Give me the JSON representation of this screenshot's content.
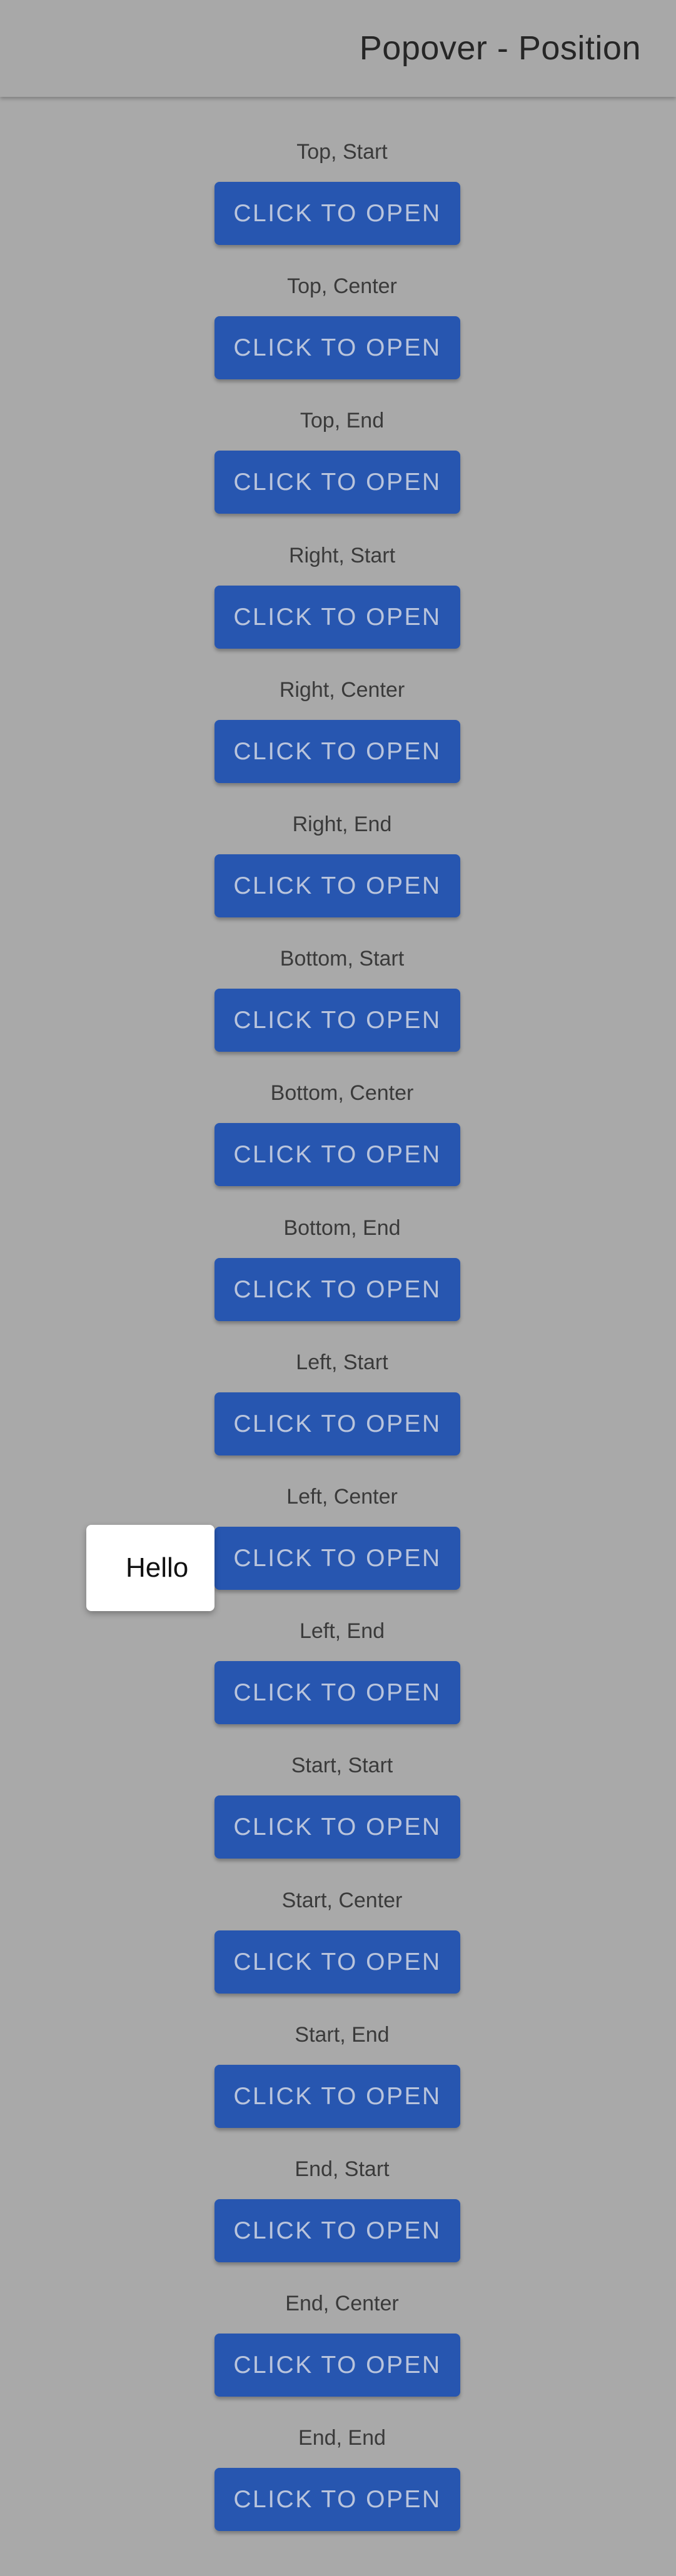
{
  "header": {
    "title": "Popover - Position"
  },
  "button_label": "CLICK TO OPEN",
  "popover": {
    "text": "Hello"
  },
  "rows": [
    {
      "label": "Top, Start"
    },
    {
      "label": "Top, Center"
    },
    {
      "label": "Top, End"
    },
    {
      "label": "Right, Start"
    },
    {
      "label": "Right, Center"
    },
    {
      "label": "Right, End"
    },
    {
      "label": "Bottom, Start"
    },
    {
      "label": "Bottom, Center"
    },
    {
      "label": "Bottom, End"
    },
    {
      "label": "Left, Start"
    },
    {
      "label": "Left, Center"
    },
    {
      "label": "Left, End"
    },
    {
      "label": "Start, Start"
    },
    {
      "label": "Start, Center"
    },
    {
      "label": "Start, End"
    },
    {
      "label": "End, Start"
    },
    {
      "label": "End, Center"
    },
    {
      "label": "End, End"
    }
  ],
  "colors": {
    "background": "#a9a9a9",
    "button": "#2756b0",
    "button_text": "#b9c4dc",
    "popover_bg": "#ffffff"
  }
}
